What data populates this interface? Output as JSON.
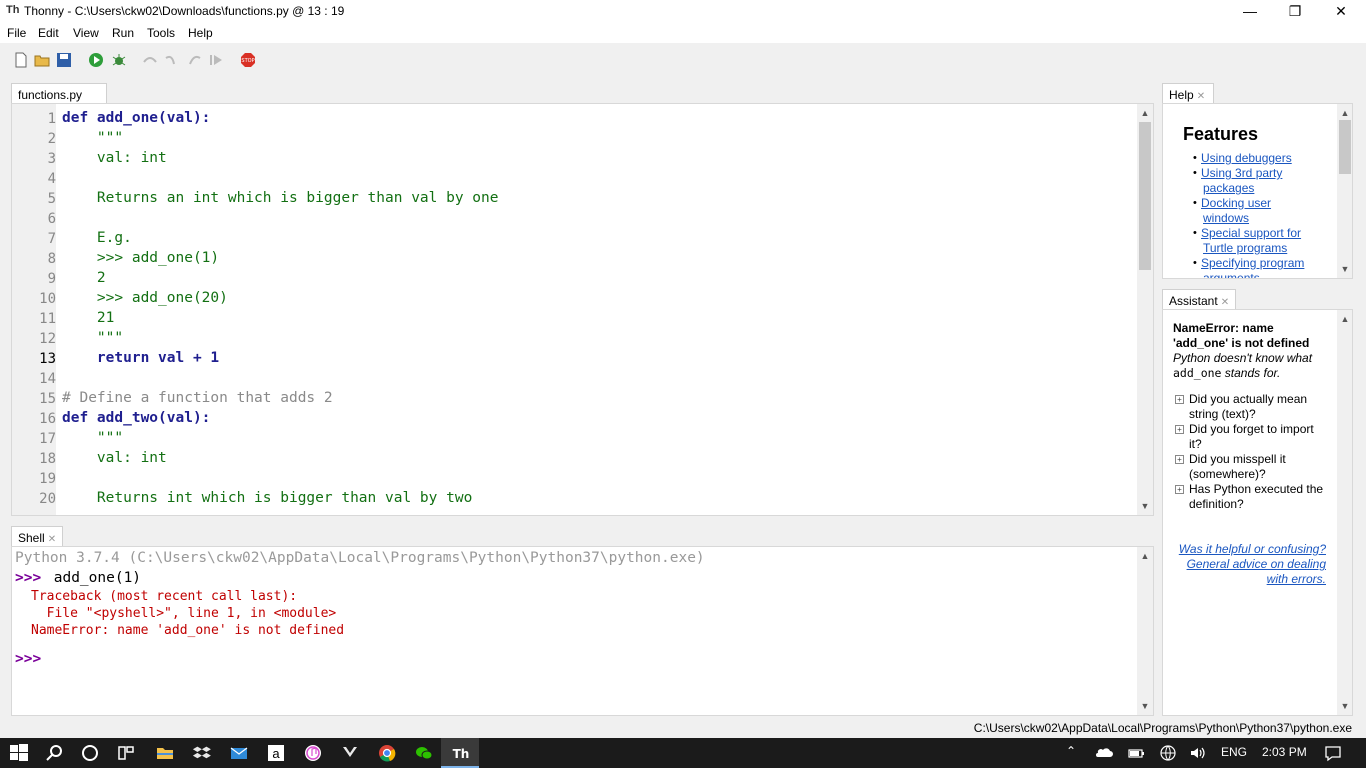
{
  "window": {
    "title": "Thonny  -  C:\\Users\\ckw02\\Downloads\\functions.py  @  13 : 19",
    "app_icon": "Th"
  },
  "menu": [
    "File",
    "Edit",
    "View",
    "Run",
    "Tools",
    "Help"
  ],
  "editor": {
    "tab_label": "functions.py *",
    "line_numbers": [
      "1",
      "2",
      "3",
      "4",
      "5",
      "6",
      "7",
      "8",
      "9",
      "10",
      "11",
      "12",
      "13",
      "14",
      "15",
      "16",
      "17",
      "18",
      "19",
      "20"
    ],
    "current_line": "13",
    "lines": [
      "def add_one(val):",
      "    \"\"\"",
      "    val: int",
      "",
      "    Returns an int which is bigger than val by one",
      "",
      "    E.g.",
      "    >>> add_one(1)",
      "    2",
      "    >>> add_one(20)",
      "    21",
      "    \"\"\"",
      "    return val + 1",
      "",
      "# Define a function that adds 2",
      "def add_two(val):",
      "    \"\"\"",
      "    val: int",
      "",
      "    Returns int which is bigger than val by two"
    ]
  },
  "shell": {
    "tab_label": "Shell",
    "header": "Python 3.7.4 (C:\\Users\\ckw02\\AppData\\Local\\Programs\\Python\\Python37\\python.exe)",
    "prompt1": ">>>",
    "command": " add_one(1)",
    "error_lines": [
      "Traceback (most recent call last):",
      "  File \"<pyshell>\", line 1, in <module>",
      "NameError: name 'add_one' is not defined"
    ],
    "prompt2": ">>>"
  },
  "help": {
    "tab_label": "Help",
    "heading": "Features",
    "links": [
      "Using debuggers",
      "Using 3rd party",
      "packages",
      "Docking user",
      "windows",
      "Special support for",
      "Turtle programs",
      "Specifying program",
      "arguments"
    ]
  },
  "assistant": {
    "tab_label": "Assistant",
    "error_title_1": "NameError: name",
    "error_title_2": "'add_one' is not defined",
    "desc_1": "Python doesn't know what",
    "desc_code": "add_one",
    "desc_2": " stands for.",
    "items": [
      [
        "Did you actually mean",
        "string (text)?"
      ],
      [
        "Did you forget to import",
        "it?"
      ],
      [
        "Did you misspell it",
        "(somewhere)?"
      ],
      [
        "Has Python executed the",
        "definition?"
      ]
    ],
    "footer_1": "Was it helpful or confusing?",
    "footer_2": "General advice on dealing",
    "footer_3": "with errors."
  },
  "status_bar": {
    "interpreter_path": "C:\\Users\\ckw02\\AppData\\Local\\Programs\\Python\\Python37\\python.exe"
  },
  "taskbar": {
    "language": "ENG",
    "time": "2:03 PM"
  },
  "colors": {
    "keyword": "#1f1f8f",
    "string": "#137013",
    "number": "#c23b00",
    "comment": "#8a8a8a",
    "error": "#c00000",
    "link": "#1a56c0"
  }
}
